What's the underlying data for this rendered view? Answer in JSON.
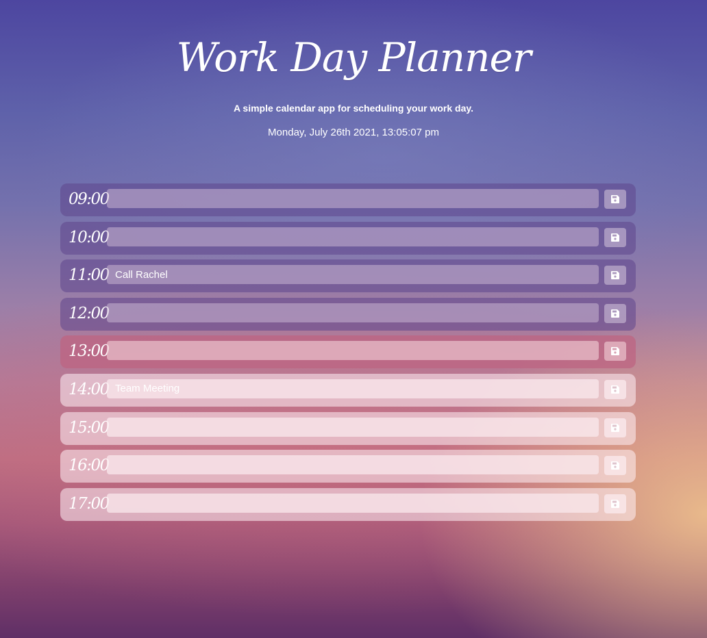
{
  "header": {
    "title": "Work Day Planner",
    "subtitle": "A simple calendar app for scheduling your work day.",
    "datetime": "Monday, July 26th 2021, 13:05:07 pm"
  },
  "planner": {
    "rows": [
      {
        "hour": "09:00",
        "text": "",
        "state": "past"
      },
      {
        "hour": "10:00",
        "text": "",
        "state": "past"
      },
      {
        "hour": "11:00",
        "text": "Call Rachel",
        "state": "past"
      },
      {
        "hour": "12:00",
        "text": "",
        "state": "past"
      },
      {
        "hour": "13:00",
        "text": "",
        "state": "present"
      },
      {
        "hour": "14:00",
        "text": "Team Meeting",
        "state": "future"
      },
      {
        "hour": "15:00",
        "text": "",
        "state": "future"
      },
      {
        "hour": "16:00",
        "text": "",
        "state": "future"
      },
      {
        "hour": "17:00",
        "text": "",
        "state": "future"
      }
    ],
    "save_icon": "floppy-disk-icon"
  },
  "colors": {
    "past": "#5f468c",
    "present": "#be6482",
    "future": "#fff0f5",
    "text": "#ffffff"
  }
}
